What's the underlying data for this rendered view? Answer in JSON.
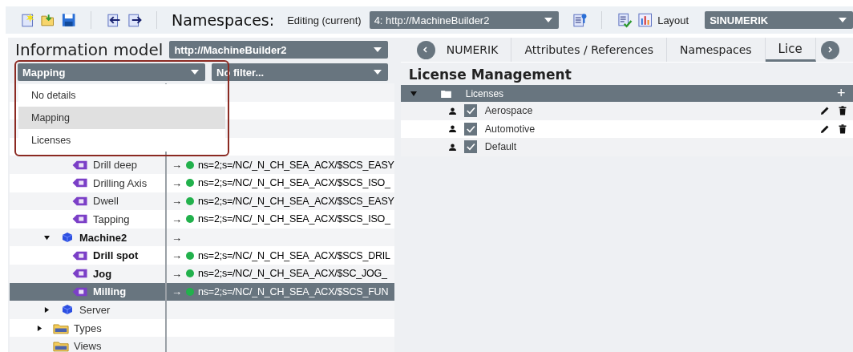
{
  "toolbar": {
    "namespaces_label": "Namespaces:",
    "editing_label": "Editing (current)",
    "namespace_select": "4: http://MachineBuilder2",
    "layout_label": "Layout",
    "layout_select": "SINUMERIK"
  },
  "information_model": {
    "title": "Information model",
    "model_select": "http://MachineBuilder2",
    "view_select": "Mapping",
    "filter_select": "No filter...",
    "view_menu": [
      {
        "label": "No details",
        "selected": false
      },
      {
        "label": "Mapping",
        "selected": true
      },
      {
        "label": "Licenses",
        "selected": false
      }
    ],
    "tree": [
      {
        "children": [
          {
            "children": [
              {
                "label": "Drill deep",
                "kind": "method",
                "bold": false,
                "selected": false,
                "mapping": {
                  "arrow": "→",
                  "color": "#22b14c",
                  "target": "ns=2;s=/NC/_N_CH_SEA_ACX/$SCS_EASY"
                }
              },
              {
                "label": "Drilling Axis",
                "kind": "method",
                "bold": false,
                "selected": false,
                "mapping": {
                  "arrow": "→",
                  "color": "#22b14c",
                  "target": "ns=2;s=/NC/_N_CH_SEA_ACX/$SCS_ISO_"
                }
              },
              {
                "label": "Dwell",
                "kind": "method",
                "bold": false,
                "selected": false,
                "mapping": {
                  "arrow": "→",
                  "color": "#22b14c",
                  "target": "ns=2;s=/NC/_N_CH_SEA_ACX/$SCS_EASY"
                }
              },
              {
                "label": "Tapping",
                "kind": "method",
                "bold": false,
                "selected": false,
                "mapping": {
                  "arrow": "→",
                  "color": "#22b14c",
                  "target": "ns=2;s=/NC/_N_CH_SEA_ACX/$SCS_ISO_"
                }
              }
            ]
          },
          {
            "label": "Machine2",
            "kind": "object",
            "bold": true,
            "selected": false,
            "expanded": true,
            "mapping": {
              "arrow": "→"
            },
            "children": [
              {
                "label": "Drill spot",
                "kind": "method",
                "bold": true,
                "selected": false,
                "mapping": {
                  "arrow": "→",
                  "color": "#22b14c",
                  "target": "ns=2;s=/NC/_N_CH_SEA_ACX/$SCS_DRIL"
                }
              },
              {
                "label": "Jog",
                "kind": "method",
                "bold": true,
                "selected": false,
                "mapping": {
                  "arrow": "→",
                  "color": "#22b14c",
                  "target": "ns=2;s=/NC/_N_CH_SEA_ACX/$SC_JOG_"
                }
              },
              {
                "label": "Milling",
                "kind": "method",
                "bold": true,
                "selected": true,
                "mapping": {
                  "arrow": "→",
                  "color": "#22b14c",
                  "target": "ns=2;s=/NC/_N_CH_SEA_ACX/$SCS_FUN"
                }
              }
            ]
          },
          {
            "label": "Server",
            "kind": "object",
            "bold": false,
            "selected": false,
            "expanded": false
          }
        ]
      },
      {
        "label": "Types",
        "kind": "folder",
        "bold": false,
        "selected": false,
        "expanded": false
      },
      {
        "label": "Views",
        "kind": "folder",
        "bold": false,
        "selected": false
      }
    ]
  },
  "details": {
    "tabs": [
      {
        "label": "NUMERIK",
        "selected": false
      },
      {
        "label": "Attributes / References",
        "selected": false
      },
      {
        "label": "Namespaces",
        "selected": false
      },
      {
        "label": "Lice",
        "selected": true
      }
    ],
    "title": "License Management",
    "licenses": {
      "label": "Licenses",
      "expanded": true,
      "add": "+",
      "rows": [
        {
          "label": "Aerospace",
          "checked": true,
          "editable": true
        },
        {
          "label": "Automotive",
          "checked": true,
          "editable": true
        },
        {
          "label": "Default",
          "checked": true,
          "editable": false
        }
      ]
    }
  }
}
